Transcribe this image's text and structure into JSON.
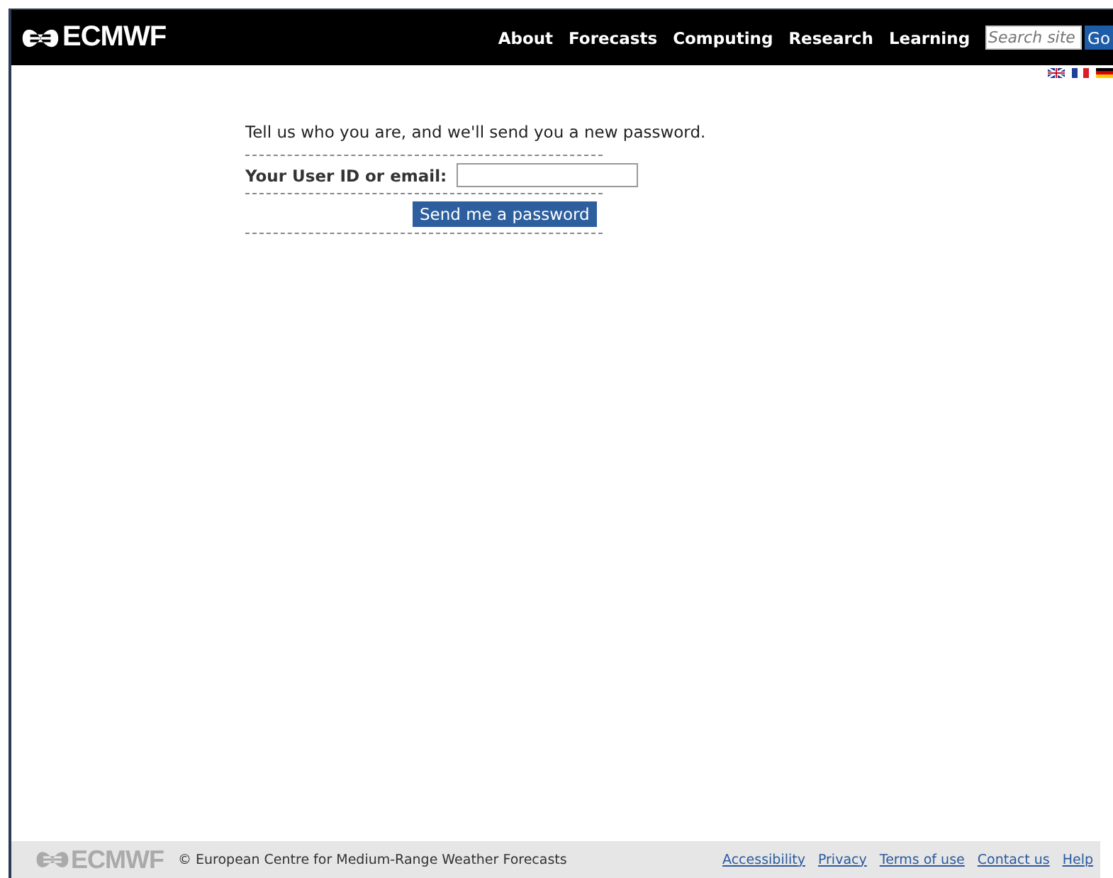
{
  "header": {
    "logo": "ECMWF",
    "nav": [
      "About",
      "Forecasts",
      "Computing",
      "Research",
      "Learning"
    ],
    "search": {
      "placeholder": "Search site"
    },
    "go_button": "Go"
  },
  "form": {
    "intro": "Tell us who you are, and we'll send you a new password.",
    "field_label": "Your User ID or email:",
    "submit": "Send me a password"
  },
  "footer": {
    "logo": "ECMWF",
    "copyright": "© European Centre for Medium-Range Weather Forecasts",
    "links": [
      "Accessibility",
      "Privacy",
      "Terms of use",
      "Contact us",
      "Help"
    ]
  }
}
